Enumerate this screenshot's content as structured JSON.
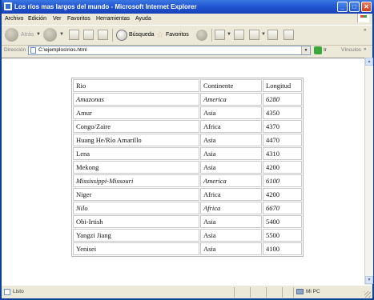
{
  "window": {
    "title": "Los ríos mas largos del mundo - Microsoft Internet Explorer"
  },
  "menubar": {
    "items": [
      "Archivo",
      "Edición",
      "Ver",
      "Favoritos",
      "Herramientas",
      "Ayuda"
    ]
  },
  "toolbar": {
    "back_label": "Atrás",
    "search_label": "Búsqueda",
    "favorites_label": "Favoritos"
  },
  "addressbar": {
    "label": "Dirección",
    "value": "C:\\ejemplos\\rios.html",
    "go_label": "Ir",
    "links_label": "Vínculos"
  },
  "table": {
    "headers": [
      "Rio",
      "Continente",
      "Longitud"
    ],
    "rows": [
      {
        "rio": "Amazonas",
        "continente": "America",
        "longitud": "6280",
        "italic": true
      },
      {
        "rio": "Amur",
        "continente": "Asia",
        "longitud": "4350",
        "italic": false
      },
      {
        "rio": "Congo/Zaire",
        "continente": "Africa",
        "longitud": "4370",
        "italic": false
      },
      {
        "rio": "Huang He/Río Amarillo",
        "continente": "Asia",
        "longitud": "4470",
        "italic": false
      },
      {
        "rio": "Lena",
        "continente": "Asia",
        "longitud": "4310",
        "italic": false
      },
      {
        "rio": "Mekong",
        "continente": "Asia",
        "longitud": "4200",
        "italic": false
      },
      {
        "rio": "Mississippi-Missouri",
        "continente": "America",
        "longitud": "6100",
        "italic": true
      },
      {
        "rio": "Niger",
        "continente": "Africa",
        "longitud": "4200",
        "italic": false
      },
      {
        "rio": "Nilo",
        "continente": "Africa",
        "longitud": "6670",
        "italic": true
      },
      {
        "rio": "Obi-Irtish",
        "continente": "Asia",
        "longitud": "5400",
        "italic": false
      },
      {
        "rio": "Yangzi Jiang",
        "continente": "Asia",
        "longitud": "5500",
        "italic": false
      },
      {
        "rio": "Yenisei",
        "continente": "Asia",
        "longitud": "4100",
        "italic": false
      }
    ]
  },
  "statusbar": {
    "status": "Listo",
    "zone": "Mi PC"
  },
  "icons": {
    "title": "ie-icon",
    "back": "back-arrow-icon",
    "forward": "forward-arrow-icon",
    "stop": "stop-icon",
    "refresh": "refresh-icon",
    "home": "home-icon",
    "search": "search-icon",
    "favorites": "star-icon",
    "history": "history-icon",
    "mail": "mail-icon",
    "print": "print-icon",
    "edit": "edit-icon"
  }
}
